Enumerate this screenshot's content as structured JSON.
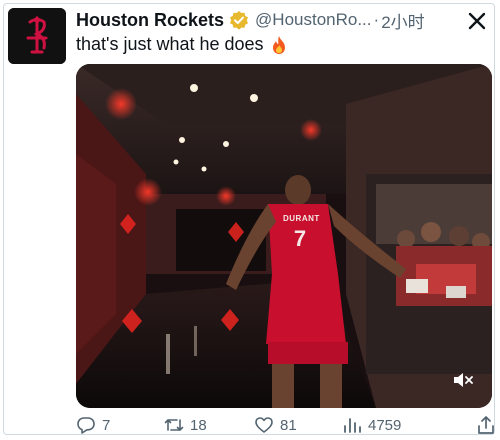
{
  "tweet": {
    "author_name": "Houston Rockets",
    "handle": "@HoustonRo...",
    "separator": "·",
    "time": "2小时",
    "text": "that's just what he does",
    "emoji": "🔥"
  },
  "media": {
    "jersey_name": "DURANT",
    "jersey_number": "7"
  },
  "actions": {
    "replies": "7",
    "retweets": "18",
    "likes": "81",
    "views": "4759"
  },
  "icons": {
    "verified": "verified-badge-icon",
    "close": "close-icon",
    "mute": "volume-muted-icon",
    "reply": "reply-icon",
    "retweet": "retweet-icon",
    "like": "heart-icon",
    "views": "views-chart-icon",
    "share": "share-icon"
  },
  "colors": {
    "verified_gold": "#e8b82f",
    "rockets_red": "#ce1141",
    "secondary_text": "#536471"
  }
}
